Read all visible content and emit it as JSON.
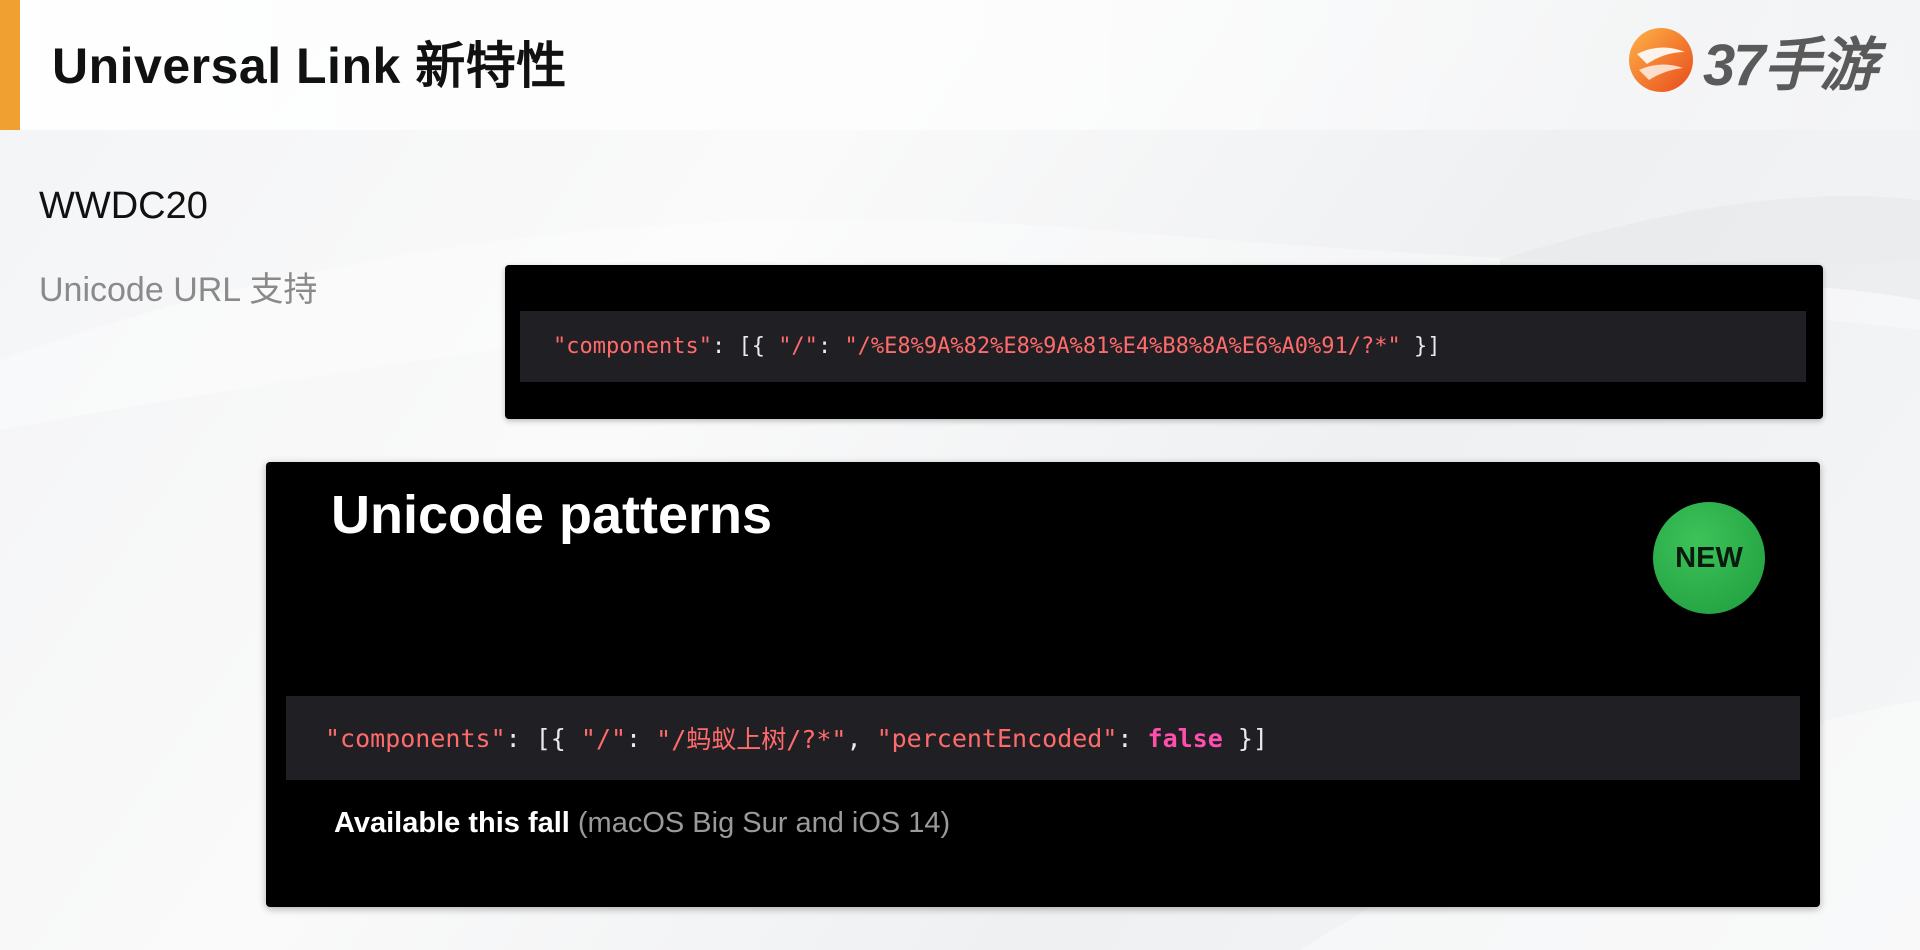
{
  "slide": {
    "title": "Universal Link 新特性",
    "section_label": "WWDC20",
    "section_sub": "Unicode URL 支持"
  },
  "logo": {
    "text": "37手游",
    "icon": "37-logo-mark-icon"
  },
  "encoded_example": {
    "key": "\"components\"",
    "p1": ": [{ ",
    "slash_key": "\"/\"",
    "p2": ": ",
    "path": "\"/%E8%9A%82%E8%9A%81%E4%B8%8A%E6%A0%91/?*\"",
    "p3": " }]"
  },
  "wwdc_card": {
    "heading": "Unicode patterns",
    "badge": "NEW",
    "code": {
      "key": "\"components\"",
      "p1": ": [{ ",
      "slash_key": "\"/\"",
      "p2": ": ",
      "path": "\"/蚂蚁上树/?*\"",
      "p3": ", ",
      "pe_key": "\"percentEncoded\"",
      "p4": ": ",
      "pe_value": "false",
      "p5": " }]"
    },
    "availability_main": "Available this fall",
    "availability_note": " (macOS Big Sur and iOS 14)"
  },
  "colors": {
    "accent": "#f0a030",
    "code_string": "#ff6b6b",
    "code_keyword": "#ff4fae",
    "badge_green": "#27a745"
  }
}
